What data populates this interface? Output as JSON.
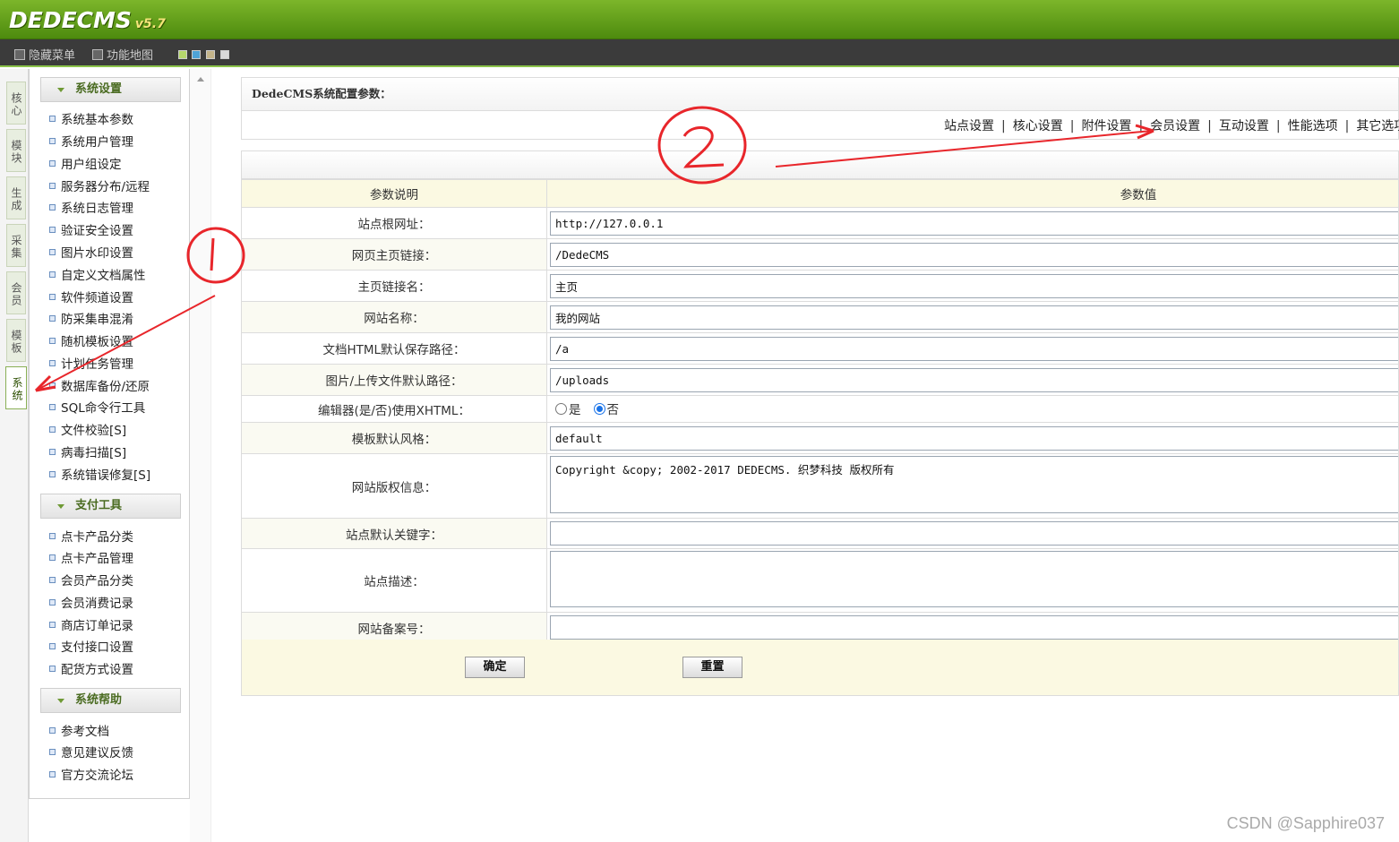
{
  "header": {
    "logo": "DEDECMS",
    "version": "v5.7"
  },
  "menubar": {
    "hide_menu": "隐藏菜单",
    "func_map": "功能地图"
  },
  "skins": [
    "#b5d66c",
    "#4fa3d7",
    "#c4b48a",
    "#d9d9d9"
  ],
  "left_tabs": [
    "核心",
    "模块",
    "生成",
    "采集",
    "会员",
    "模板",
    "系统"
  ],
  "active_left_tab": "系统",
  "sidebar": {
    "groups": [
      {
        "title": "系统设置",
        "items": [
          "系统基本参数",
          "系统用户管理",
          "用户组设定",
          "服务器分布/远程",
          "系统日志管理",
          "验证安全设置",
          "图片水印设置",
          "自定义文档属性",
          "软件频道设置",
          "防采集串混淆",
          "随机模板设置",
          "计划任务管理",
          "数据库备份/还原",
          "SQL命令行工具",
          "文件校验[S]",
          "病毒扫描[S]",
          "系统错误修复[S]"
        ]
      },
      {
        "title": "支付工具",
        "items": [
          "点卡产品分类",
          "点卡产品管理",
          "会员产品分类",
          "会员消费记录",
          "商店订单记录",
          "支付接口设置",
          "配货方式设置"
        ]
      },
      {
        "title": "系统帮助",
        "items": [
          "参考文档",
          "意见建议反馈",
          "官方交流论坛"
        ]
      }
    ]
  },
  "main": {
    "title": "DedeCMS系统配置参数：",
    "tabs": [
      "站点设置",
      "核心设置",
      "附件设置",
      "会员设置",
      "互动设置",
      "性能选项",
      "其它选项"
    ],
    "col_key": "参数说明",
    "col_val": "参数值",
    "rows": [
      {
        "label": "站点根网址：",
        "value": "http://127.0.0.1"
      },
      {
        "label": "网页主页链接：",
        "value": "/DedeCMS"
      },
      {
        "label": "主页链接名：",
        "value": "主页"
      },
      {
        "label": "网站名称：",
        "value": "我的网站"
      },
      {
        "label": "文档HTML默认保存路径：",
        "value": "/a"
      },
      {
        "label": "图片/上传文件默认路径：",
        "value": "/uploads"
      }
    ],
    "xhtml": {
      "label": "编辑器(是/否)使用XHTML：",
      "yes": "是",
      "no": "否",
      "selected": "否"
    },
    "template_style": {
      "label": "模板默认风格：",
      "value": "default"
    },
    "copyright": {
      "label": "网站版权信息：",
      "value": "Copyright &copy; 2002-2017 DEDECMS. 织梦科技 版权所有"
    },
    "keywords": {
      "label": "站点默认关键字：",
      "value": ""
    },
    "description": {
      "label": "站点描述：",
      "value": ""
    },
    "icp": {
      "label": "网站备案号：",
      "value": ""
    },
    "submit": "确定",
    "reset": "重置"
  },
  "watermark": "CSDN @Sapphire037",
  "annotations": {
    "one": "①",
    "two": "②",
    "color": "#e8262b"
  }
}
